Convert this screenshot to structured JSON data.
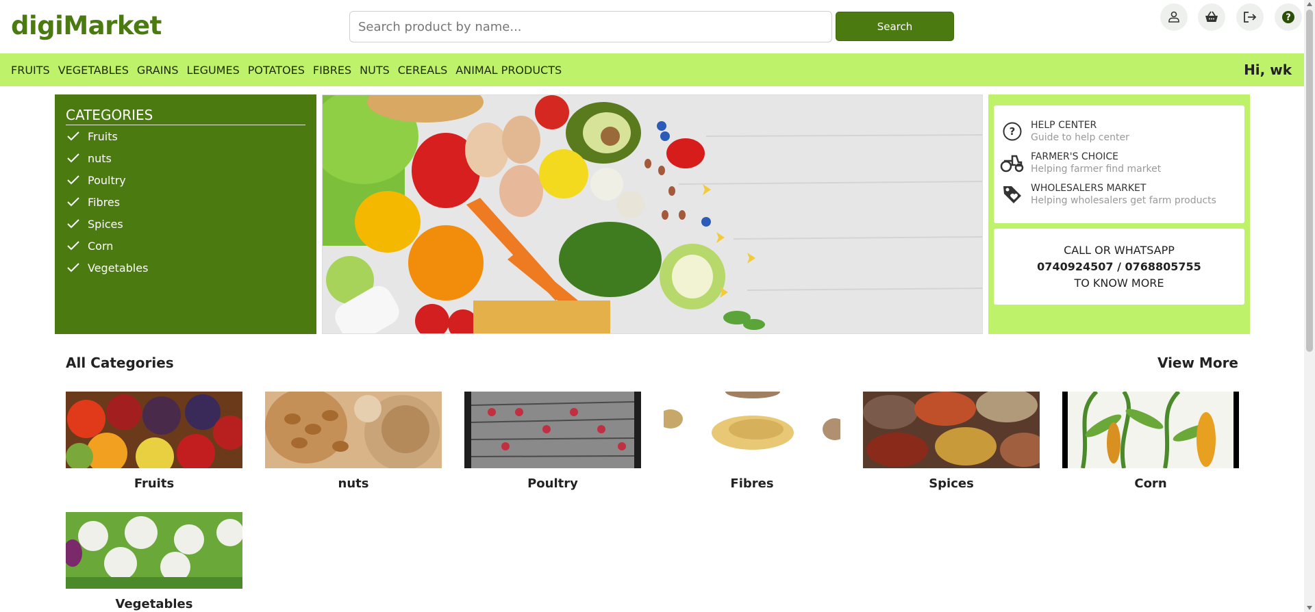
{
  "header": {
    "logo": "digiMarket",
    "search_placeholder": "Search product by name...",
    "search_button": "Search",
    "icons": [
      "user-icon",
      "basket-icon",
      "logout-icon",
      "help-icon"
    ]
  },
  "nav": {
    "items": [
      "FRUITS",
      "VEGETABLES",
      "GRAINS",
      "LEGUMES",
      "POTATOES",
      "FIBRES",
      "NUTS",
      "CEREALS",
      "ANIMAL PRODUCTS"
    ],
    "greeting": "Hi, wk"
  },
  "categories_panel": {
    "title": "CATEGORIES",
    "items": [
      "Fruits",
      "nuts",
      "Poultry",
      "Fibres",
      "Spices",
      "Corn",
      "Vegetables"
    ]
  },
  "info_panel": {
    "rows": [
      {
        "title": "HELP CENTER",
        "subtitle": "Guide to help center",
        "icon": "question-circle-icon"
      },
      {
        "title": "FARMER'S CHOICE",
        "subtitle": "Helping farmer find market",
        "icon": "tractor-icon"
      },
      {
        "title": "WHOLESALERS MARKET",
        "subtitle": "Helping wholesalers get farm products",
        "icon": "tag-icon"
      }
    ],
    "call": {
      "line1": "CALL OR WHATSAPP",
      "numbers": "0740924507 / 0768805755",
      "line3": "TO KNOW MORE"
    }
  },
  "all_categories": {
    "title": "All Categories",
    "view_more": "View More",
    "tiles": [
      "Fruits",
      "nuts",
      "Poultry",
      "Fibres",
      "Spices",
      "Corn",
      "Vegetables"
    ]
  },
  "colors": {
    "brand_green": "#4a7a10",
    "nav_lime": "#bef26a"
  }
}
